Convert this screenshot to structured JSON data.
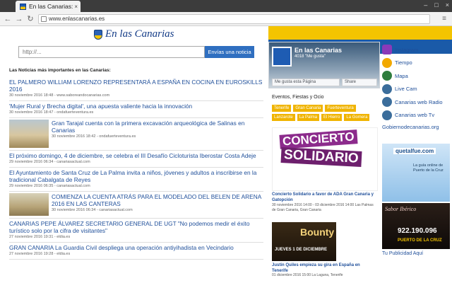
{
  "browser": {
    "tab_title": "En las Canarias: noti",
    "tab_close": "×",
    "url": "www.enlascanarias.es",
    "back_icon": "back-arrow-icon",
    "forward_icon": "forward-arrow-icon",
    "reload_icon": "reload-icon",
    "menu_icon": "kebab-menu-icon",
    "back_glyph": "←",
    "forward_glyph": "→",
    "reload_glyph": "↻",
    "menu_glyph": "≡",
    "window_buttons": [
      "–",
      "□",
      "×"
    ]
  },
  "site": {
    "logo_text": "En las Canarias",
    "search_placeholder": "http://...",
    "search_button": "Envías una noticia",
    "brand_blue": "#1a5aa8",
    "brand_yellow": "#f4c400"
  },
  "news": {
    "heading": "Las Noticias más importantes en las Canarias:",
    "items": [
      {
        "title": "EL PALMERO WILLIAM LORENZO REPRESENTARÁ A ESPAÑA EN COCINA EN EUROSKILLS 2016",
        "meta": "30 noviembre 2016 18:48 - www.saboreandocanarias.com"
      },
      {
        "title": "'Mujer Rural y Brecha digital', una apuesta valiente hacia la innovación",
        "meta": "30 noviembre 2016 18:47 - ondafuerteventura.es"
      },
      {
        "title": "Gran Tarajal cuenta con la primera excavación arqueológica de Salinas en Canarias",
        "meta": "30 noviembre 2016 18:42 - ondafuerteventura.es"
      },
      {
        "title": "El próximo domingo, 4 de diciembre, se celebra el III Desafío Cicloturista Iberostar Costa Adeje",
        "meta": "29 noviembre 2016 06:34 - canariasactual.com"
      },
      {
        "title": "El Ayuntamiento de Santa Cruz de La Palma invita a niños, jóvenes y adultos a inscribirse en la tradicional Cabalgata de Reyes",
        "meta": "29 noviembre 2016 06:35 - canariasactual.com"
      },
      {
        "title": "COMIENZA LA CUENTA ATRÁS PARA EL MODELADO DEL BELEN DE ARENA 2016 EN LAS CANTERAS",
        "meta": "30 noviembre 2016 06:34 - canariasactual.com"
      },
      {
        "title": "CANARIAS PEPE ÁLVAREZ SECRETARIO GENERAL DE UGT \"No podemos medir el éxito turístico solo por la cifra de visitantes\"",
        "meta": "27 noviembre 2016 19:31 - eldia.es"
      },
      {
        "title": "GRAN CANARIA La Guardia Civil despliega una operación antiyihadista en Vecindario",
        "meta": "27 noviembre 2016 19:28 - eldia.es"
      }
    ]
  },
  "facebook": {
    "name": "En las Canarias",
    "likes": "4018 \"Me gusta\"",
    "like_button": "Me gusta esta Página",
    "share_button": "Share"
  },
  "events": {
    "heading": "Eventos, Fiestas y Ocio",
    "tags": [
      "Tenerife",
      "Gran Canaria",
      "Fuerteventura",
      "Lanzarote",
      "La Palma",
      "El Hierro",
      "La Gomera"
    ],
    "event1": {
      "image_line1": "CONCIERTO",
      "image_line2": "SOLIDARIO",
      "title": "Concierto Solidario a favor de ADA Gran Canaria y Gatopción",
      "meta": "30 noviembre 2016 14:00 - 03 diciembre 2016 14:00 Las Palmas de Gran Canaria, Gran Canaria"
    },
    "event2": {
      "image_title": "Bounty",
      "image_date": "JUEVES 1 DE DICIEMBRE",
      "title": "Justin Quiles empieza su gira en España en Tenerife",
      "meta": "01 diciembre 2016 15:00 La Laguna, Tenerife"
    }
  },
  "sidebar": {
    "links": [
      {
        "label": "Instagram",
        "icon": "instagram-icon",
        "color": "#8a3ab9"
      },
      {
        "label": "Tiempo",
        "icon": "sun-icon",
        "color": "#f2a900"
      },
      {
        "label": "Mapa",
        "icon": "map-icon",
        "color": "#2f7d3e"
      },
      {
        "label": "Live Cam",
        "icon": "camera-icon",
        "color": "#3b6d9b"
      },
      {
        "label": "Canarias web Radio",
        "icon": "radio-icon",
        "color": "#3b6d9b"
      },
      {
        "label": "Canarias web Tv",
        "icon": "tv-icon",
        "color": "#3b6d9b"
      }
    ],
    "gob_link": "Gobiernodecanarias.org",
    "ad1_brand": "quetalfue.com",
    "ad1_text": "La guía online de Puerto de la Cruz",
    "ad2_brand": "Sabor Ibérico",
    "ad2_phone": "922.190.096",
    "ad2_place": "PUERTO DE LA CRUZ",
    "ad_link": "Tu Publicidad Aquí"
  }
}
